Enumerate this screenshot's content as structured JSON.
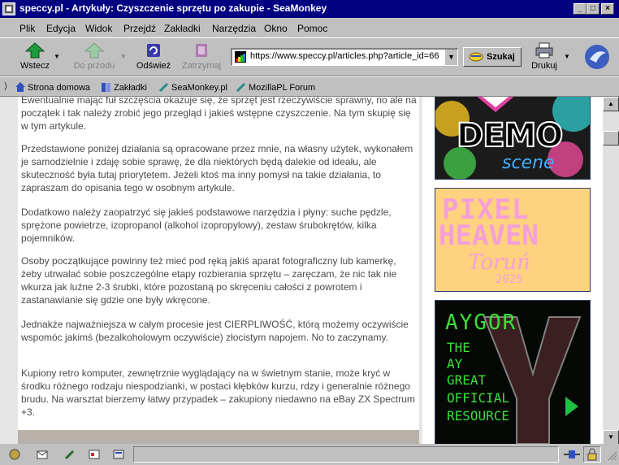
{
  "window": {
    "title": "speccy.pl - Artykuły: Czyszczenie sprzętu po zakupie - SeaMonkey",
    "minimize": "_",
    "maximize": "□",
    "close": "×"
  },
  "menu": [
    "Plik",
    "Edycja",
    "Widok",
    "Przejdź",
    "Zakładki",
    "Narzędzia",
    "Okno",
    "Pomoc"
  ],
  "toolbar": {
    "back_label": "Wstecz",
    "forward_label": "Do przodu",
    "reload_label": "Odśwież",
    "stop_label": "Zatrzymaj",
    "url": "https://www.speccy.pl/articles.php?article_id=66",
    "search_label": "Szukaj",
    "print_label": "Drukuj"
  },
  "bookmarks": [
    "Strona domowa",
    "Zakładki",
    "SeaMonkey.pl",
    "MozillaPL Forum"
  ],
  "article": {
    "paragraphs": [
      "Ewentualnie mając fuł szczęścia okazuje się, że sprzęt jest rzeczywiście sprawny, no ale na początek i tak należy zrobić jego przegląd i jakieś wstępne czyszczenie. Na tym skupię się w tym artykule.",
      "Przedstawione poniżej działania są opracowane przez mnie, na własny użytek, wykonałem je samodzielnie i zdaję sobie sprawę, że dla niektórych będą dalekie od ideału, ale skuteczność była tutaj priorytetem. Jeżeli ktoś ma inny pomysł na takie działania, to zapraszam do opisania tego w osobnym artykule.",
      "Dodatkowo należy zaopatrzyć się jakieś podstawowe narzędzia i płyny: suche pędzle, sprężone powietrze, izopropanol (alkohol izopropylowy), zestaw śrubokrętów, kilka pojemników.",
      "Osoby początkujące powinny też mieć pod ręką jakiś aparat fotograficzny lub kamerkę, żeby utrwalać sobie poszczególne etapy rozbierania sprzętu – zaręczam, że nic tak nie wkurza jak luźne 2-3 śrubki, które pozostaną po skręceniu całości z powrotem i zastanawianie się gdzie one były wkręcone.",
      "Jednakże najważniejsza w całym procesie jest CIERPLIWOŚĆ, którą możemy oczywiście wspomóc jakimś (bezalkoholowym oczywiście) złocistym napojem. No to zaczynamy.",
      "Kupiony retro komputer, zewnętrznie wyglądający na w świetnym stanie, może kryć w środku różnego rodzaju niespodzianki, w postaci kłębków kurzu, rdzy i generalnie różnego brudu. Na warsztat bierzemy łatwy przypadek – zakupiony niedawno na eBay ZX Spectrum +3."
    ]
  },
  "sidebar": {
    "ads": [
      {
        "line1": "DEMO",
        "line2": "scene"
      },
      {
        "line1": "PIXEL",
        "line2": "HEAVEN",
        "line3": "Toruń",
        "line4": "2025"
      },
      {
        "line1": "AYGOR",
        "lines": [
          "THE",
          "AY",
          "GREAT",
          "OFFICIAL",
          "RESOURCE"
        ]
      }
    ]
  },
  "colors": {
    "titlebar": "#000080",
    "pixel_bg": "#ffd27f",
    "pixel_text": "#f4a0d8",
    "aygor_text": "#38e038"
  }
}
